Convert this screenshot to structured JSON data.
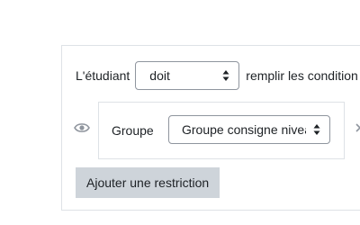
{
  "restriction": {
    "prefix": "L'étudiant",
    "must_select": {
      "value": "doit"
    },
    "suffix": "remplir les condition",
    "condition": {
      "type_label": "Groupe",
      "group_select": {
        "value": "Groupe consigne nivea"
      },
      "eye_icon": "eye-icon",
      "delete_icon": "close-icon"
    },
    "add_button_label": "Ajouter une restriction"
  }
}
